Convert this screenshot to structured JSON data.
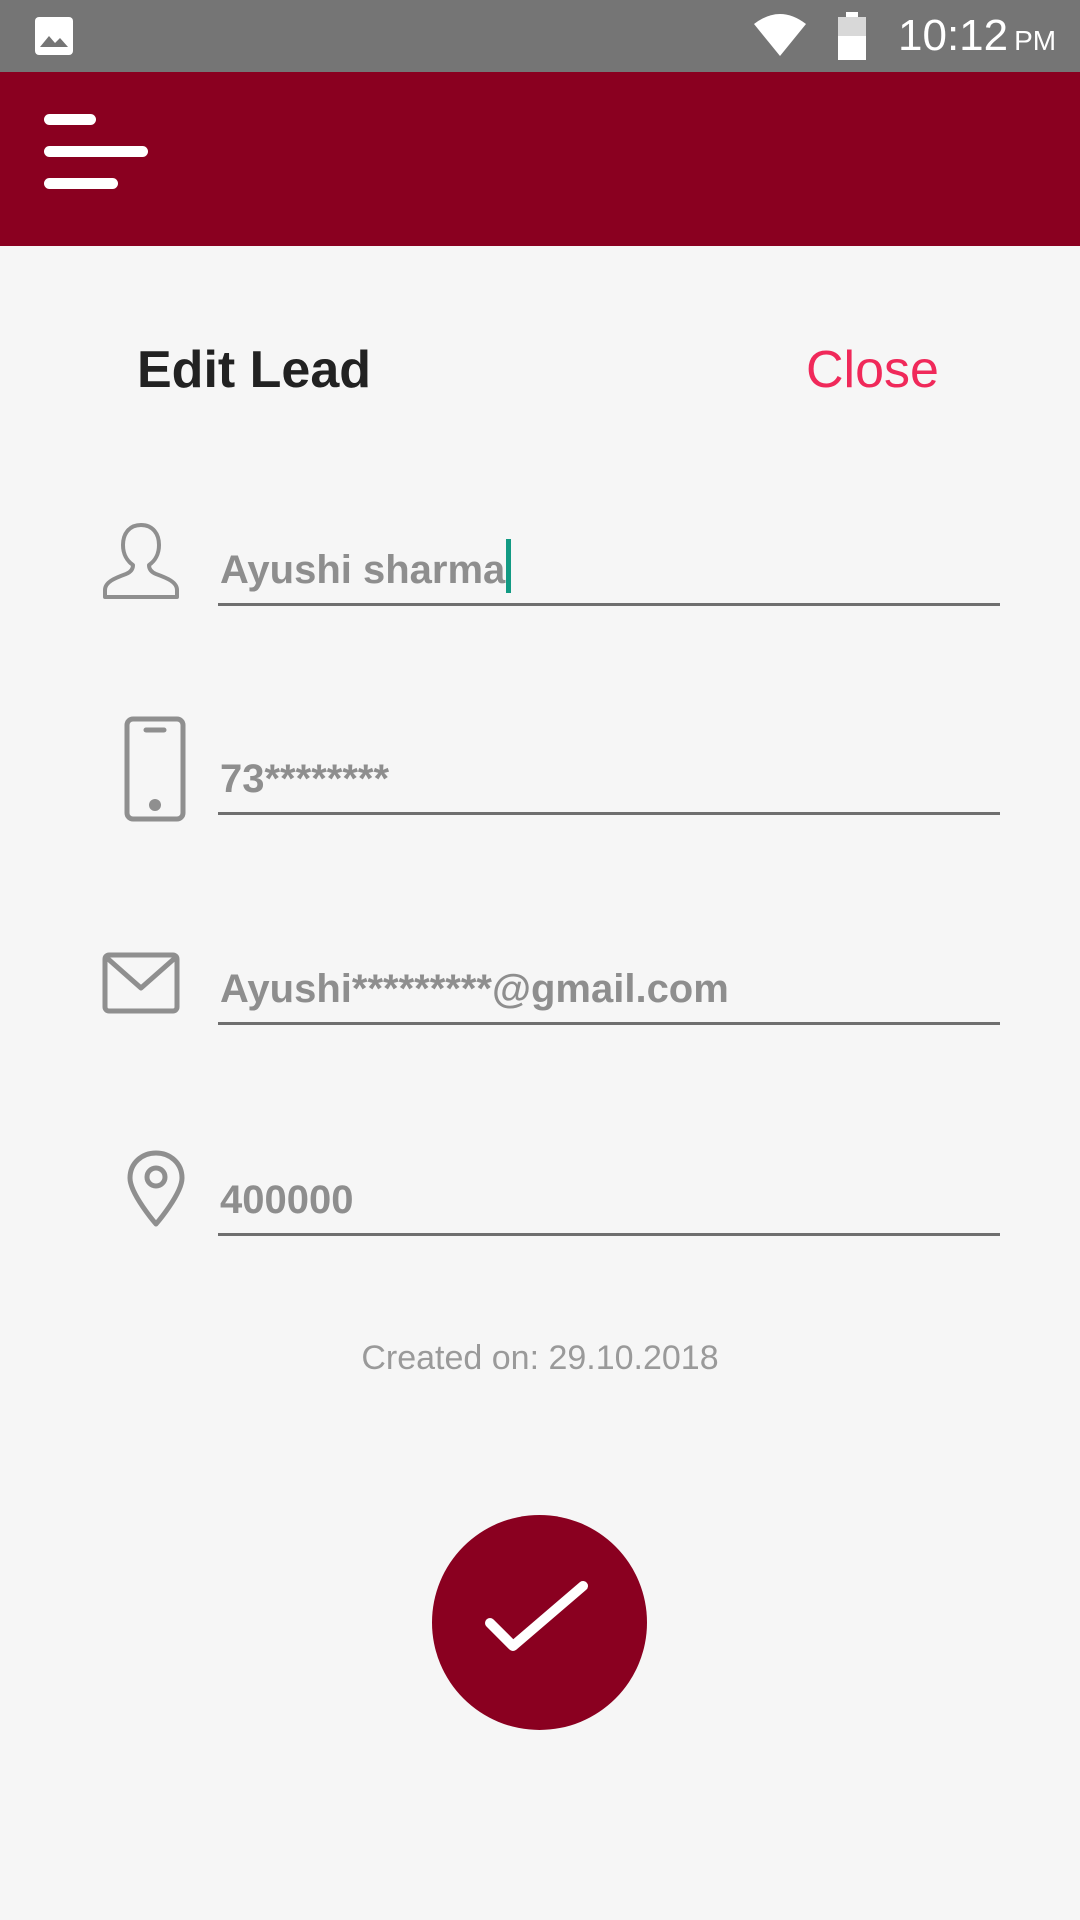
{
  "status_bar": {
    "time": "10:12",
    "ampm": "PM",
    "icons": [
      "gallery-icon",
      "wifi-icon",
      "battery-icon"
    ]
  },
  "app_bar": {
    "menu_icon": "menu-icon",
    "color": "#8a0020"
  },
  "header": {
    "title": "Edit Lead",
    "close_label": "Close",
    "close_color": "#f0295a"
  },
  "form": {
    "name": {
      "icon": "person-icon",
      "value": "Ayushi sharma"
    },
    "phone": {
      "icon": "phone-icon",
      "value": "73********"
    },
    "email": {
      "icon": "mail-icon",
      "value": "Ayushi*********@gmail.com"
    },
    "pincode": {
      "icon": "location-pin-icon",
      "value": "400000"
    }
  },
  "meta": {
    "created_on": "Created on: 29.10.2018"
  },
  "save_button": {
    "icon": "checkmark-icon"
  }
}
